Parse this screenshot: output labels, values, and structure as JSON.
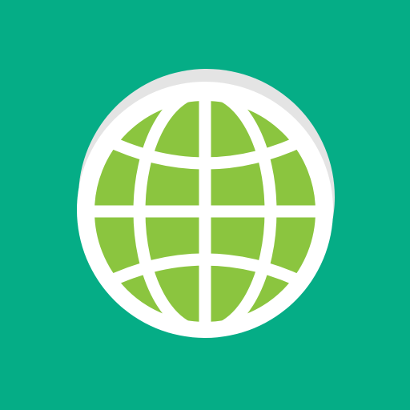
{
  "icon": {
    "name": "globe-icon",
    "colors": {
      "background": "#05AD86",
      "badge": "#FFFFFF",
      "badge_shadow": "#E4E4E4",
      "globe_fill": "#8BC53F",
      "grid_lines": "#FFFFFF"
    }
  }
}
